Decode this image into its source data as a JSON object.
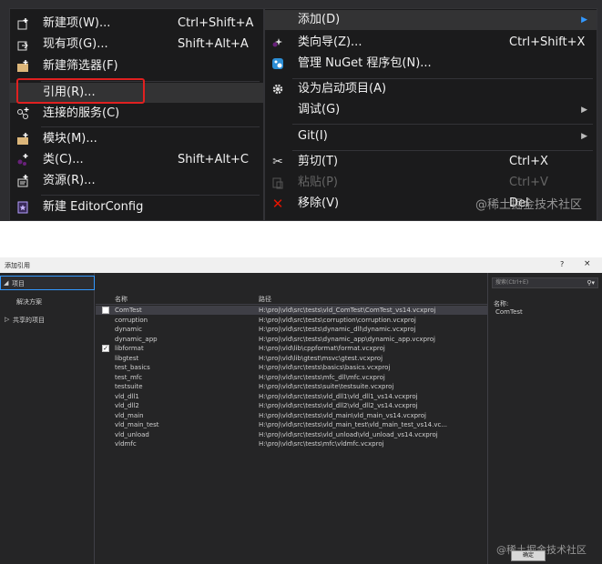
{
  "context_menu": {
    "items": [
      {
        "icon": "new-item-icon",
        "label": "新建项(W)...",
        "shortcut": "Ctrl+Shift+A"
      },
      {
        "icon": "existing-item-icon",
        "label": "现有项(G)...",
        "shortcut": "Shift+Alt+A"
      },
      {
        "icon": "filter-icon",
        "label": "新建筛选器(F)",
        "shortcut": ""
      },
      {
        "icon": "",
        "label": "引用(R)...",
        "shortcut": ""
      },
      {
        "icon": "connected-service-icon",
        "label": "连接的服务(C)",
        "shortcut": ""
      },
      {
        "icon": "module-icon",
        "label": "模块(M)...",
        "shortcut": ""
      },
      {
        "icon": "class-icon",
        "label": "类(C)...",
        "shortcut": "Shift+Alt+C"
      },
      {
        "icon": "resource-icon",
        "label": "资源(R)...",
        "shortcut": ""
      },
      {
        "icon": "editorconfig-icon",
        "label": "新建 EditorConfig",
        "shortcut": ""
      }
    ]
  },
  "project_menu": {
    "items": [
      {
        "icon": "",
        "label": "添加(D)",
        "shortcut": "",
        "submenu": true
      },
      {
        "icon": "class-wizard-icon",
        "label": "类向导(Z)...",
        "shortcut": "Ctrl+Shift+X",
        "submenu": false
      },
      {
        "icon": "nuget-icon",
        "label": "管理 NuGet 程序包(N)...",
        "shortcut": "",
        "submenu": false
      },
      {
        "icon": "gear-icon",
        "label": "设为启动项目(A)",
        "shortcut": "",
        "submenu": false
      },
      {
        "icon": "",
        "label": "调试(G)",
        "shortcut": "",
        "submenu": true
      },
      {
        "icon": "",
        "label": "Git(I)",
        "shortcut": "",
        "submenu": true
      },
      {
        "icon": "scissors-icon",
        "label": "剪切(T)",
        "shortcut": "Ctrl+X",
        "submenu": false
      },
      {
        "icon": "paste-icon",
        "label": "粘贴(P)",
        "shortcut": "Ctrl+V",
        "submenu": false
      },
      {
        "icon": "remove-icon",
        "label": "移除(V)",
        "shortcut": "Del",
        "submenu": false
      }
    ],
    "watermark": "@稀土掘金技术社区"
  },
  "dialog": {
    "title": "添加引用",
    "help": "?",
    "close": "×",
    "left": {
      "projects": "项目",
      "solution": "解决方案",
      "shared": "共享的项目"
    },
    "columns": {
      "name": "名称",
      "path": "路径"
    },
    "rows": [
      {
        "name": "ComTest",
        "path": "H:\\proj\\vld\\src\\tests\\vld_ComTest\\ComTest_vs14.vcxproj",
        "checked": false,
        "checkbox": true,
        "selected": true
      },
      {
        "name": "corruption",
        "path": "H:\\proj\\vld\\src\\tests\\corruption\\corruption.vcxproj",
        "checked": false,
        "checkbox": false,
        "selected": false
      },
      {
        "name": "dynamic",
        "path": "H:\\proj\\vld\\src\\tests\\dynamic_dll\\dynamic.vcxproj",
        "checked": false,
        "checkbox": false,
        "selected": false
      },
      {
        "name": "dynamic_app",
        "path": "H:\\proj\\vld\\src\\tests\\dynamic_app\\dynamic_app.vcxproj",
        "checked": false,
        "checkbox": false,
        "selected": false
      },
      {
        "name": "libformat",
        "path": "H:\\proj\\vld\\lib\\cppformat\\format.vcxproj",
        "checked": true,
        "checkbox": true,
        "selected": false
      },
      {
        "name": "libgtest",
        "path": "H:\\proj\\vld\\lib\\gtest\\msvc\\gtest.vcxproj",
        "checked": false,
        "checkbox": false,
        "selected": false
      },
      {
        "name": "test_basics",
        "path": "H:\\proj\\vld\\src\\tests\\basics\\basics.vcxproj",
        "checked": false,
        "checkbox": false,
        "selected": false
      },
      {
        "name": "test_mfc",
        "path": "H:\\proj\\vld\\src\\tests\\mfc_dll\\mfc.vcxproj",
        "checked": false,
        "checkbox": false,
        "selected": false
      },
      {
        "name": "testsuite",
        "path": "H:\\proj\\vld\\src\\tests\\suite\\testsuite.vcxproj",
        "checked": false,
        "checkbox": false,
        "selected": false
      },
      {
        "name": "vld_dll1",
        "path": "H:\\proj\\vld\\src\\tests\\vld_dll1\\vld_dll1_vs14.vcxproj",
        "checked": false,
        "checkbox": false,
        "selected": false
      },
      {
        "name": "vld_dll2",
        "path": "H:\\proj\\vld\\src\\tests\\vld_dll2\\vld_dll2_vs14.vcxproj",
        "checked": false,
        "checkbox": false,
        "selected": false
      },
      {
        "name": "vld_main",
        "path": "H:\\proj\\vld\\src\\tests\\vld_main\\vld_main_vs14.vcxproj",
        "checked": false,
        "checkbox": false,
        "selected": false
      },
      {
        "name": "vld_main_test",
        "path": "H:\\proj\\vld\\src\\tests\\vld_main_test\\vld_main_test_vs14.vc...",
        "checked": false,
        "checkbox": false,
        "selected": false
      },
      {
        "name": "vld_unload",
        "path": "H:\\proj\\vld\\src\\tests\\vld_unload\\vld_unload_vs14.vcxproj",
        "checked": false,
        "checkbox": false,
        "selected": false
      },
      {
        "name": "vldmfc",
        "path": "H:\\proj\\vld\\src\\tests\\mfc\\vldmfc.vcxproj",
        "checked": false,
        "checkbox": false,
        "selected": false
      }
    ],
    "search_placeholder": "搜索(Ctrl+E)",
    "detail": {
      "name_label": "名称:",
      "name_value": "ComTest"
    },
    "ok_button": "确定",
    "watermark": "@稀土掘金技术社区"
  }
}
